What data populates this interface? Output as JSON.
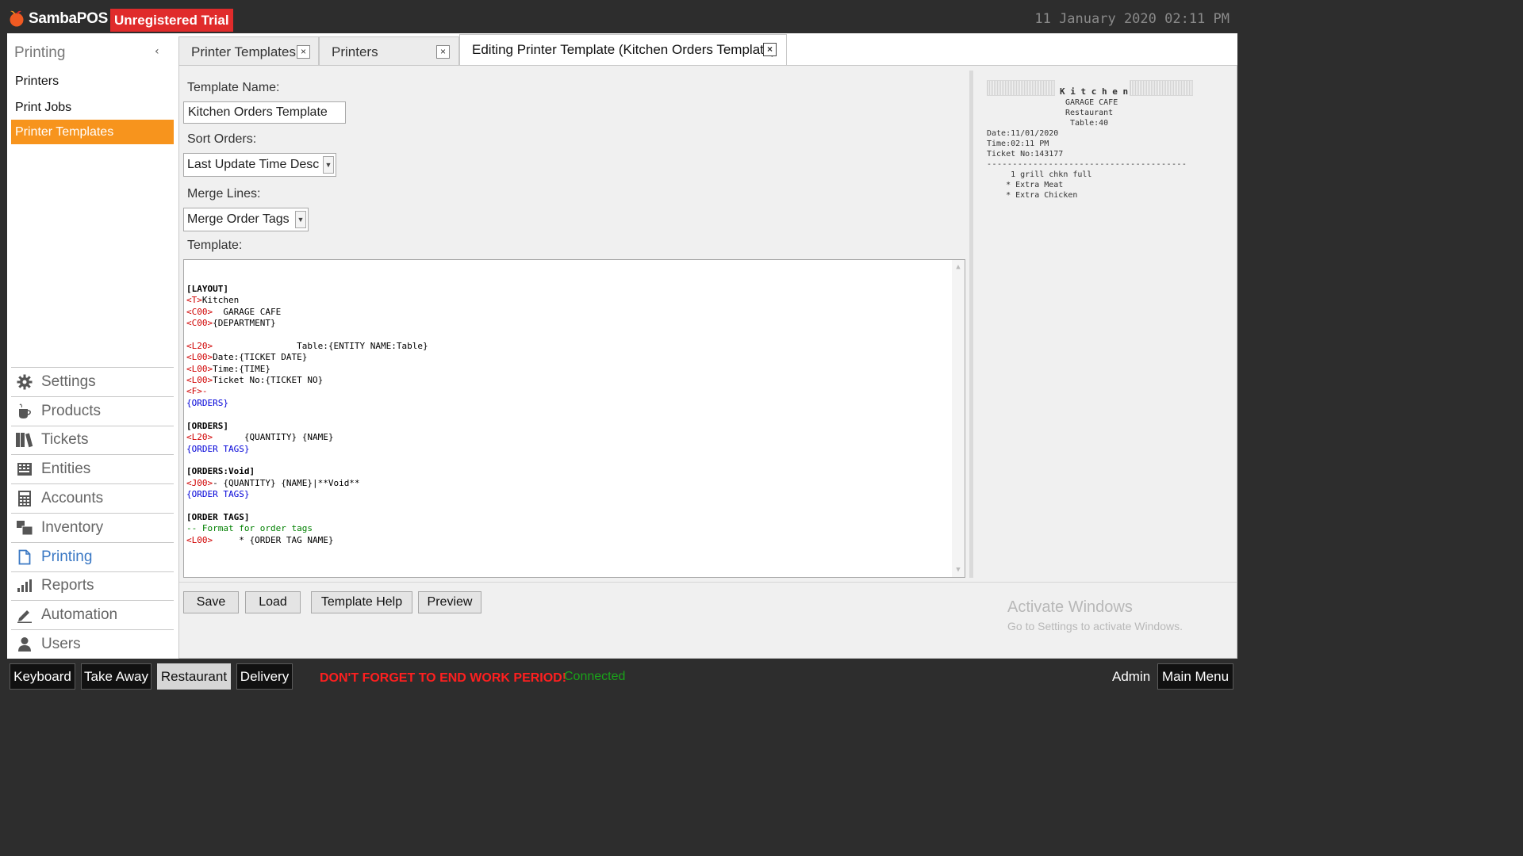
{
  "app": {
    "name": "SambaPOS",
    "trial_badge": "Unregistered Trial",
    "datetime": "11 January 2020 02:11 PM"
  },
  "sidebar": {
    "title": "Printing",
    "collapse_icon": "chevron-left-icon",
    "links": [
      {
        "label": "Printers",
        "active": false
      },
      {
        "label": "Print Jobs",
        "active": false
      },
      {
        "label": "Printer Templates",
        "active": true
      }
    ],
    "menu": [
      {
        "label": "Settings",
        "icon": "gear-icon"
      },
      {
        "label": "Products",
        "icon": "coffee-cup-icon"
      },
      {
        "label": "Tickets",
        "icon": "books-icon"
      },
      {
        "label": "Entities",
        "icon": "keyboard-icon"
      },
      {
        "label": "Accounts",
        "icon": "calculator-icon"
      },
      {
        "label": "Inventory",
        "icon": "boxes-icon"
      },
      {
        "label": "Printing",
        "icon": "document-icon",
        "active": true
      },
      {
        "label": "Reports",
        "icon": "bar-chart-icon"
      },
      {
        "label": "Automation",
        "icon": "pencil-icon"
      },
      {
        "label": "Users",
        "icon": "user-icon"
      }
    ]
  },
  "tabs": [
    {
      "label": "Printer Templates",
      "active": false
    },
    {
      "label": "Printers",
      "active": false
    },
    {
      "label": "Editing Printer Template (Kitchen Orders Template)",
      "active": true
    }
  ],
  "form": {
    "name_label": "Template Name:",
    "name_value": "Kitchen Orders Template",
    "sort_label": "Sort Orders:",
    "sort_value": "Last Update Time Desc",
    "merge_label": "Merge Lines:",
    "merge_value": "Merge Order Tags",
    "template_label": "Template:"
  },
  "template_lines": [
    {
      "parts": [
        {
          "t": "[LAYOUT]",
          "c": "section"
        }
      ]
    },
    {
      "parts": [
        {
          "t": "<T>",
          "c": "tag"
        },
        {
          "t": "Kitchen",
          "c": "text"
        }
      ]
    },
    {
      "parts": [
        {
          "t": "<C00>",
          "c": "tag"
        },
        {
          "t": "  GARAGE CAFE",
          "c": "text"
        }
      ]
    },
    {
      "parts": [
        {
          "t": "<C00>",
          "c": "tag"
        },
        {
          "t": "{DEPARTMENT}",
          "c": "text"
        }
      ]
    },
    {
      "parts": []
    },
    {
      "parts": [
        {
          "t": "<L20>",
          "c": "tag"
        },
        {
          "t": "                Table:{ENTITY NAME:Table}",
          "c": "text"
        }
      ]
    },
    {
      "parts": [
        {
          "t": "<L00>",
          "c": "tag"
        },
        {
          "t": "Date:{TICKET DATE}",
          "c": "text"
        }
      ]
    },
    {
      "parts": [
        {
          "t": "<L00>",
          "c": "tag"
        },
        {
          "t": "Time:{TIME}",
          "c": "text"
        }
      ]
    },
    {
      "parts": [
        {
          "t": "<L00>",
          "c": "tag"
        },
        {
          "t": "Ticket No:{TICKET NO}",
          "c": "text"
        }
      ]
    },
    {
      "parts": [
        {
          "t": "<F>-",
          "c": "tag"
        }
      ]
    },
    {
      "parts": [
        {
          "t": "{ORDERS}",
          "c": "blue"
        }
      ]
    },
    {
      "parts": []
    },
    {
      "parts": [
        {
          "t": "[ORDERS]",
          "c": "section"
        }
      ]
    },
    {
      "parts": [
        {
          "t": "<L20>",
          "c": "tag"
        },
        {
          "t": "      {QUANTITY} {NAME}",
          "c": "text"
        }
      ]
    },
    {
      "parts": [
        {
          "t": "{ORDER TAGS}",
          "c": "blue"
        }
      ]
    },
    {
      "parts": []
    },
    {
      "parts": [
        {
          "t": "[ORDERS:Void]",
          "c": "section"
        }
      ]
    },
    {
      "parts": [
        {
          "t": "<J00>",
          "c": "tag"
        },
        {
          "t": "- {QUANTITY} {NAME}|**Void**",
          "c": "text"
        }
      ]
    },
    {
      "parts": [
        {
          "t": "{ORDER TAGS}",
          "c": "blue"
        }
      ]
    },
    {
      "parts": []
    },
    {
      "parts": [
        {
          "t": "[ORDER TAGS]",
          "c": "section"
        }
      ]
    },
    {
      "parts": [
        {
          "t": "-- Format for order tags",
          "c": "comment"
        }
      ]
    },
    {
      "parts": [
        {
          "t": "<L00>",
          "c": "tag"
        },
        {
          "t": "     * {ORDER TAG NAME}",
          "c": "text"
        }
      ]
    }
  ],
  "preview": {
    "title": "K i t c h e n",
    "lines": [
      "GARAGE CAFE",
      "Restaurant",
      "Table:40"
    ],
    "details": [
      "Date:11/01/2020",
      "Time:02:11 PM",
      "Ticket No:143177"
    ],
    "separator": "---------------------------------------",
    "order_lines": [
      "     1 grill chkn full",
      "    * Extra Meat",
      "    * Extra Chicken"
    ]
  },
  "buttons": {
    "save": "Save",
    "load": "Load",
    "help": "Template Help",
    "preview": "Preview"
  },
  "watermark": {
    "title": "Activate Windows",
    "subtitle": "Go to Settings to activate Windows."
  },
  "footer": {
    "departments": [
      {
        "label": "Keyboard",
        "active": false
      },
      {
        "label": "Take Away",
        "active": false
      },
      {
        "label": "Restaurant",
        "active": true
      },
      {
        "label": "Delivery",
        "active": false
      }
    ],
    "warning": "DON'T FORGET TO END WORK PERIOD!",
    "connection": "Connected",
    "user": "Admin",
    "main_menu": "Main Menu"
  },
  "colors": {
    "accent": "#f7941d",
    "trial_badge": "#e02b2b",
    "warning": "#ff1f1f",
    "connected": "#19a319",
    "active_nav": "#3a78c4"
  }
}
